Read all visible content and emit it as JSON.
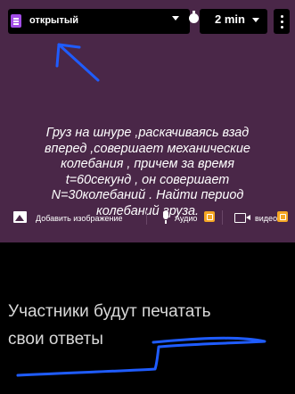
{
  "topbar": {
    "mode_label": "открытый",
    "mode_icon": "doc-list-icon",
    "timer_icon": "stopwatch-icon",
    "timer_label": "2 min",
    "more_icon": "kebab-menu-icon"
  },
  "question": {
    "lines": [
      "Груз на шнуре ,раскачиваясь взад",
      "вперед ,совершает механические",
      "колебания , причем за время",
      "t=60секунд , он совершает",
      "N=30колебаний . Найти период",
      "колебаний груза."
    ]
  },
  "media": {
    "add_image_label": "Добавить изображение",
    "audio_label": "Аудио",
    "video_label": "видео"
  },
  "answer": {
    "line1": "Участники будут печатать",
    "line2": "свои ответы"
  },
  "colors": {
    "card_background": "#4a2748",
    "page_background": "#000000",
    "mode_icon": "#a24de6",
    "pro_badge": "#f5a623",
    "ink": "#1f5cff"
  }
}
